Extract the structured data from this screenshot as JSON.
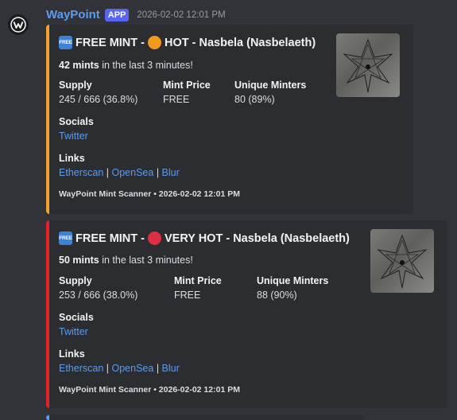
{
  "bot": {
    "name": "WayPoint",
    "badge": "APP",
    "timestamp": "2026-02-02 12:01 PM"
  },
  "colors": {
    "hot": "#f1a12c",
    "very_hot": "#e5202b",
    "link": "#5b9cf0"
  },
  "embeds": [
    {
      "tag": "FREE",
      "title_prefix": "FREE MINT -",
      "heat": "HOT - Nasbela (Nasbelaeth)",
      "dot_color": "#f09a1d",
      "mints_bold": "42 mints",
      "mints_rest": " in the last 3 minutes!",
      "supply_label": "Supply",
      "supply_value": "245 / 666 (36.8%)",
      "price_label": "Mint Price",
      "price_value": "FREE",
      "minters_label": "Unique Minters",
      "minters_value": "80 (89%)",
      "socials_label": "Socials",
      "twitter": "Twitter",
      "links_label": "Links",
      "etherscan": "Etherscan",
      "opensea": "OpenSea",
      "blur": "Blur",
      "footer": "WayPoint Mint Scanner • 2026-02-02 12:01 PM"
    },
    {
      "tag": "FREE",
      "title_prefix": "FREE MINT -",
      "heat": "VERY HOT - Nasbela (Nasbelaeth)",
      "dot_color": "#dd2e44",
      "mints_bold": "50 mints",
      "mints_rest": " in the last 3 minutes!",
      "supply_label": "Supply",
      "supply_value": "253 / 666 (38.0%)",
      "price_label": "Mint Price",
      "price_value": "FREE",
      "minters_label": "Unique Minters",
      "minters_value": "88 (90%)",
      "socials_label": "Socials",
      "twitter": "Twitter",
      "links_label": "Links",
      "etherscan": "Etherscan",
      "opensea": "OpenSea",
      "blur": "Blur",
      "footer": "WayPoint Mint Scanner • 2026-02-02 12:01 PM"
    }
  ]
}
